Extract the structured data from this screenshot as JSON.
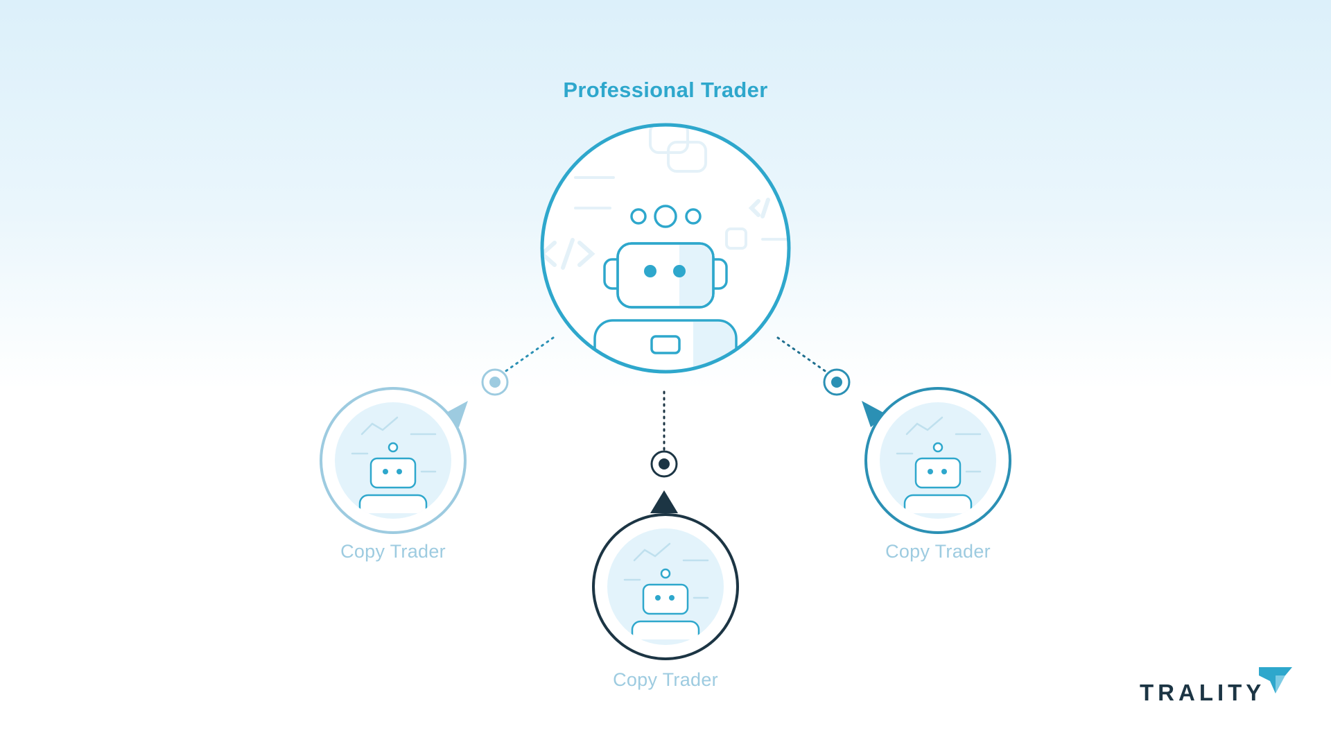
{
  "professional": {
    "label": "Professional Trader"
  },
  "copy_traders": [
    {
      "label": "Copy Trader"
    },
    {
      "label": "Copy Trader"
    },
    {
      "label": "Copy Trader"
    }
  ],
  "brand": {
    "name": "TRALITY"
  },
  "colors": {
    "primary": "#2ea7cc",
    "light": "#9dcbe0",
    "mid": "#2b90b4",
    "dark": "#1c3544",
    "fill": "#e3f3fb"
  },
  "icons": [
    "robot-icon",
    "python-logo-icon",
    "code-brackets-icon",
    "chart-icon",
    "brand-logo-icon"
  ]
}
